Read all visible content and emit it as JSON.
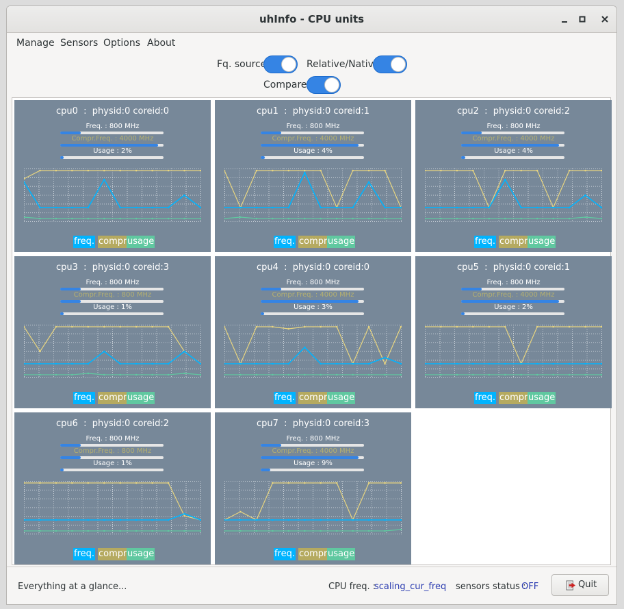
{
  "window": {
    "title": "uhInfo - CPU units"
  },
  "menu": [
    "Manage",
    "Sensors",
    "Options",
    "About"
  ],
  "controls": {
    "fq_source": {
      "label": "Fq. source",
      "on": true
    },
    "relative_native": {
      "label": "Relative/Native",
      "on": true
    },
    "compare": {
      "label": "Compare",
      "on": true
    }
  },
  "legend": {
    "freq": "freq.",
    "compr": "compr",
    "usage": "usage"
  },
  "colors": {
    "panel_bg": "#778899",
    "freq": "#00b4ff",
    "compr": "#e8d580",
    "usage": "#60c8a0",
    "accent": "#3584e4"
  },
  "cpus": [
    {
      "title": "cpu0  :  physid:0 coreid:0",
      "freq_label": "Freq. : 800 MHz",
      "freq_level": 0.2,
      "compr_label": "Compr.Freq. : 4000 MHz",
      "compr_level": 0.95,
      "usage_label": "Usage : 2%",
      "usage_level": 0.02,
      "freq_series": [
        0.72,
        0.1,
        0.1,
        0.1,
        0.1,
        0.78,
        0.1,
        0.1,
        0.1,
        0.1,
        0.4,
        0.1
      ],
      "compr_series": [
        0.8,
        1.0,
        1.0,
        1.0,
        1.0,
        1.0,
        1.0,
        1.0,
        1.0,
        1.0,
        1.0,
        1.0
      ],
      "usage_series": [
        0.05,
        0.0,
        0.0,
        0.0,
        0.0,
        0.0,
        0.0,
        0.0,
        0.0,
        0.0,
        0.0,
        0.0
      ]
    },
    {
      "title": "cpu1  :  physid:0 coreid:1",
      "freq_label": "Freq. : 800 MHz",
      "freq_level": 0.2,
      "compr_label": "Compr.Freq. : 4000 MHz",
      "compr_level": 0.95,
      "usage_label": "Usage : 4%",
      "usage_level": 0.04,
      "freq_series": [
        0.1,
        0.1,
        0.1,
        0.1,
        0.1,
        0.95,
        0.1,
        0.1,
        0.1,
        0.72,
        0.1,
        0.1
      ],
      "compr_series": [
        1.0,
        0.1,
        1.0,
        1.0,
        1.0,
        1.0,
        1.0,
        0.1,
        1.0,
        1.0,
        1.0,
        0.1
      ],
      "usage_series": [
        0.0,
        0.05,
        0.0,
        0.0,
        0.0,
        0.0,
        0.0,
        0.0,
        0.0,
        0.0,
        0.0,
        0.0
      ]
    },
    {
      "title": "cpu2  :  physid:0 coreid:2",
      "freq_label": "Freq. : 800 MHz",
      "freq_level": 0.2,
      "compr_label": "Compr.Freq. : 4000 MHz",
      "compr_level": 0.95,
      "usage_label": "Usage : 4%",
      "usage_level": 0.04,
      "freq_series": [
        0.1,
        0.1,
        0.1,
        0.1,
        0.1,
        0.78,
        0.1,
        0.1,
        0.1,
        0.1,
        0.4,
        0.1
      ],
      "compr_series": [
        1.0,
        1.0,
        1.0,
        1.0,
        0.1,
        1.0,
        1.0,
        1.0,
        0.1,
        1.0,
        1.0,
        1.0
      ],
      "usage_series": [
        0.0,
        0.0,
        0.0,
        0.0,
        0.0,
        0.0,
        0.0,
        0.0,
        0.0,
        0.0,
        0.05,
        0.0
      ]
    },
    {
      "title": "cpu3  :  physid:0 coreid:3",
      "freq_label": "Freq. : 800 MHz",
      "freq_level": 0.2,
      "compr_label": "Compr.Freq. : 800 MHz",
      "compr_level": 0.2,
      "usage_label": "Usage : 1%",
      "usage_level": 0.01,
      "freq_series": [
        0.1,
        0.1,
        0.1,
        0.1,
        0.1,
        0.4,
        0.1,
        0.1,
        0.1,
        0.1,
        0.4,
        0.1
      ],
      "compr_series": [
        1.0,
        0.4,
        1.0,
        1.0,
        1.0,
        1.0,
        1.0,
        1.0,
        1.0,
        1.0,
        0.4,
        0.1
      ],
      "usage_series": [
        0.0,
        0.0,
        0.0,
        0.0,
        0.05,
        0.0,
        0.0,
        0.0,
        0.0,
        0.0,
        0.05,
        0.0
      ]
    },
    {
      "title": "cpu4  :  physid:0 coreid:0",
      "freq_label": "Freq. : 800 MHz",
      "freq_level": 0.2,
      "compr_label": "Compr.Freq. : 4000 MHz",
      "compr_level": 0.95,
      "usage_label": "Usage : 3%",
      "usage_level": 0.03,
      "freq_series": [
        0.1,
        0.1,
        0.1,
        0.1,
        0.1,
        0.5,
        0.1,
        0.1,
        0.1,
        0.1,
        0.25,
        0.1
      ],
      "compr_series": [
        1.0,
        0.1,
        1.0,
        1.0,
        0.95,
        1.0,
        1.0,
        1.0,
        0.1,
        1.0,
        0.1,
        1.0
      ],
      "usage_series": [
        0.0,
        0.0,
        0.0,
        0.0,
        0.0,
        0.0,
        0.0,
        0.0,
        0.0,
        0.0,
        0.0,
        0.0
      ]
    },
    {
      "title": "cpu5  :  physid:0 coreid:1",
      "freq_label": "Freq. : 800 MHz",
      "freq_level": 0.2,
      "compr_label": "Compr.Freq. : 4000 MHz",
      "compr_level": 0.95,
      "usage_label": "Usage : 2%",
      "usage_level": 0.02,
      "freq_series": [
        0.1,
        0.1,
        0.1,
        0.1,
        0.1,
        0.1,
        0.1,
        0.1,
        0.1,
        0.1,
        0.1,
        0.1
      ],
      "compr_series": [
        1.0,
        1.0,
        1.0,
        1.0,
        1.0,
        1.0,
        0.1,
        1.0,
        1.0,
        1.0,
        1.0,
        1.0
      ],
      "usage_series": [
        0.0,
        0.0,
        0.0,
        0.0,
        0.0,
        0.0,
        0.0,
        0.0,
        0.0,
        0.0,
        0.0,
        0.0
      ]
    },
    {
      "title": "cpu6  :  physid:0 coreid:2",
      "freq_label": "Freq. : 800 MHz",
      "freq_level": 0.2,
      "compr_label": "Compr.Freq. : 800 MHz",
      "compr_level": 0.2,
      "usage_label": "Usage : 1%",
      "usage_level": 0.01,
      "freq_series": [
        0.1,
        0.1,
        0.1,
        0.1,
        0.1,
        0.1,
        0.1,
        0.1,
        0.1,
        0.1,
        0.25,
        0.1
      ],
      "compr_series": [
        1.0,
        1.0,
        1.0,
        1.0,
        1.0,
        1.0,
        1.0,
        1.0,
        1.0,
        1.0,
        0.2,
        0.1
      ],
      "usage_series": [
        0.0,
        0.0,
        0.0,
        0.0,
        0.0,
        0.0,
        0.0,
        0.0,
        0.0,
        0.0,
        0.0,
        0.0
      ]
    },
    {
      "title": "cpu7  :  physid:0 coreid:3",
      "freq_label": "Freq. : 800 MHz",
      "freq_level": 0.2,
      "compr_label": "Compr.Freq. : 4000 MHz",
      "compr_level": 0.95,
      "usage_label": "Usage : 9%",
      "usage_level": 0.09,
      "freq_series": [
        0.1,
        0.1,
        0.1,
        0.1,
        0.1,
        0.1,
        0.1,
        0.1,
        0.1,
        0.1,
        0.1,
        0.1
      ],
      "compr_series": [
        0.1,
        0.3,
        0.1,
        1.0,
        1.0,
        1.0,
        1.0,
        1.0,
        0.1,
        1.0,
        1.0,
        1.0
      ],
      "usage_series": [
        0.0,
        0.0,
        0.0,
        0.0,
        0.0,
        0.0,
        0.0,
        0.0,
        0.0,
        0.0,
        0.0,
        0.05
      ]
    }
  ],
  "status": {
    "message": "Everything at a glance...",
    "cpu_freq_label": "CPU freq. :",
    "cpu_freq_value": "scaling_cur_freq",
    "sensors_label": "sensors status :",
    "sensors_value": "OFF",
    "quit_label": "Quit"
  }
}
